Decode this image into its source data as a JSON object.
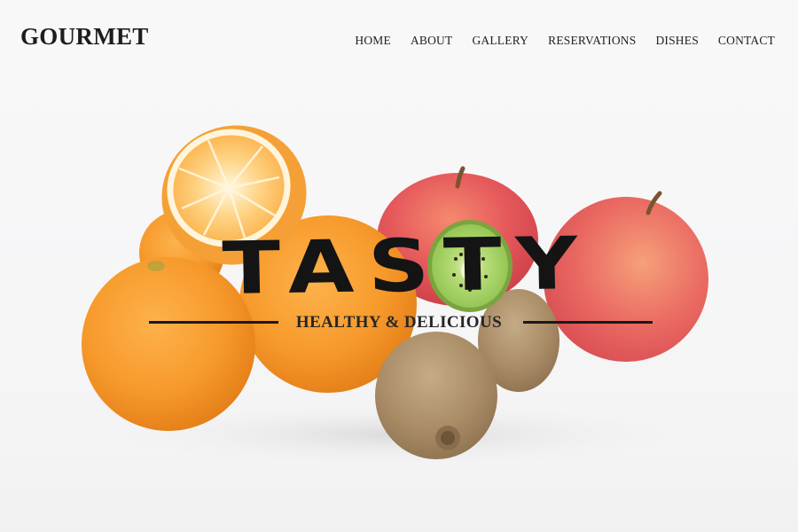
{
  "brand": {
    "name": "GOURMET"
  },
  "nav": {
    "items": [
      {
        "label": "HOME"
      },
      {
        "label": "ABOUT"
      },
      {
        "label": "GALLERY"
      },
      {
        "label": "RESERVATIONS"
      },
      {
        "label": "DISHES"
      },
      {
        "label": "CONTACT"
      }
    ]
  },
  "hero": {
    "title": "TASTY",
    "subtitle": "HEALTHY & DELICIOUS",
    "image_subject": "fruit-photo"
  },
  "colors": {
    "background": "#f7f7f8",
    "text": "#1d1d1d",
    "orange": "#f5982a",
    "apple_red": "#e2545a",
    "kiwi_skin": "#a58a66",
    "kiwi_flesh": "#9fcf62"
  }
}
